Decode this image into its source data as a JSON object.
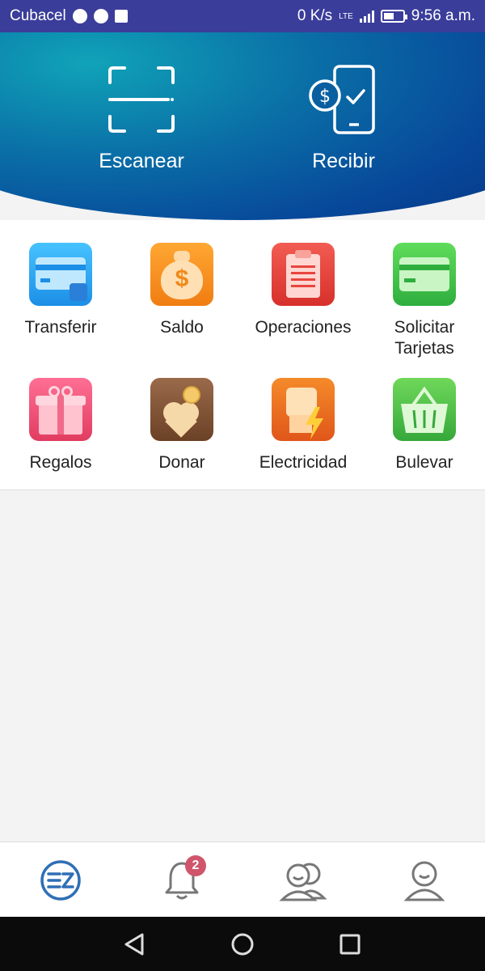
{
  "status_bar": {
    "carrier": "Cubacel",
    "speed": "0 K/s",
    "network": "LTE",
    "time": "9:56 a.m.",
    "battery_level": 0.55
  },
  "hero": {
    "scan_label": "Escanear",
    "receive_label": "Recibir"
  },
  "grid": {
    "items": [
      {
        "label": "Transferir",
        "icon": "card-transfer-icon",
        "color": "#2aa8f0"
      },
      {
        "label": "Saldo",
        "icon": "money-bag-icon",
        "color": "#f39a1e"
      },
      {
        "label": "Operaciones",
        "icon": "clipboard-list-icon",
        "color": "#e8453f"
      },
      {
        "label": "Solicitar Tarjetas",
        "icon": "card-icon",
        "color": "#3cc24e"
      },
      {
        "label": "Regalos",
        "icon": "gift-icon",
        "color": "#f2567a"
      },
      {
        "label": "Donar",
        "icon": "donate-heart-icon",
        "color": "#8a5a3c"
      },
      {
        "label": "Electricidad",
        "icon": "fist-lightning-icon",
        "color": "#ec7a1e"
      },
      {
        "label": "Bulevar",
        "icon": "basket-icon",
        "color": "#4dbf3d"
      }
    ]
  },
  "bottom_nav": {
    "notifications_badge": "2",
    "items": [
      "home-logo-icon",
      "bell-icon",
      "contacts-icon",
      "profile-icon"
    ]
  },
  "colors": {
    "status_bar": "#3a3d9a",
    "accent": "#2f6fb5",
    "badge": "#d0556b"
  }
}
